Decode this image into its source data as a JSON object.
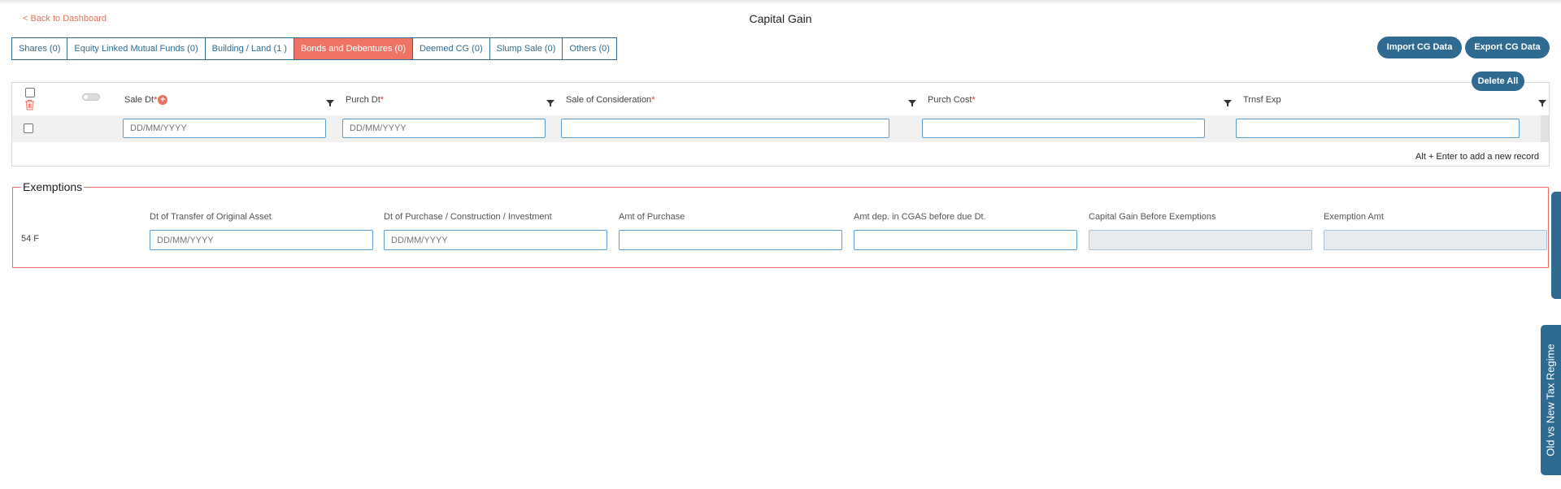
{
  "nav": {
    "back_label": "< Back to Dashboard"
  },
  "page": {
    "title": "Capital Gain"
  },
  "tabs": [
    {
      "label": "Shares (0)"
    },
    {
      "label": "Equity Linked Mutual Funds (0)"
    },
    {
      "label": "Building / Land (1 )"
    },
    {
      "label": "Bonds and Debentures (0)",
      "active": true
    },
    {
      "label": "Deemed CG (0)"
    },
    {
      "label": "Slump Sale (0)"
    },
    {
      "label": "Others (0)"
    }
  ],
  "actions": {
    "import_label": "Import CG Data",
    "export_label": "Export CG Data",
    "delete_all_label": "Delete All"
  },
  "grid": {
    "columns": [
      {
        "label": "Sale Dt",
        "required": "*"
      },
      {
        "label": "Purch Dt",
        "required": "*"
      },
      {
        "label": "Sale of Consideration",
        "required": "*"
      },
      {
        "label": "Purch Cost",
        "required": "*"
      },
      {
        "label": "Trnsf Exp",
        "required": ""
      }
    ],
    "add_glyph": "+",
    "row": {
      "sale_dt_placeholder": "DD/MM/YYYY",
      "purch_dt_placeholder": "DD/MM/YYYY",
      "sale_consideration": "",
      "purch_cost": "",
      "trnsf_exp": ""
    },
    "hint": "Alt + Enter to add a new record"
  },
  "exemptions": {
    "title": "Exemptions",
    "row_label": "54 F",
    "labels": {
      "dt_transfer": "Dt of Transfer of Original Asset",
      "dt_purchase": "Dt of Purchase / Construction / Investment",
      "amt_purchase": "Amt of Purchase",
      "amt_cgas": "Amt dep. in CGAS before due Dt.",
      "cg_before": "Capital Gain Before Exemptions",
      "exemption_amt": "Exemption Amt"
    },
    "values": {
      "dt_transfer_placeholder": "DD/MM/YYYY",
      "dt_purchase_placeholder": "DD/MM/YYYY",
      "amt_purchase": "",
      "amt_cgas": "",
      "cg_before": "",
      "exemption_amt": ""
    }
  },
  "side": {
    "regime_label": "Old vs New Tax Regime"
  },
  "colors": {
    "primary": "#2f6a91",
    "accent": "#ef7466",
    "link": "#e8705d"
  },
  "icons": [
    "trash-icon",
    "filter-icon",
    "plus-circle-icon"
  ]
}
